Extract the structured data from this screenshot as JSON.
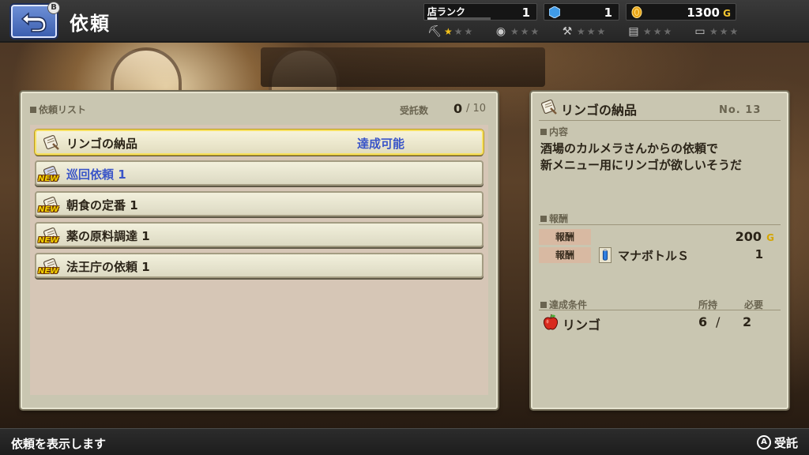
{
  "header": {
    "title": "依頼",
    "back_badge": "B",
    "shop_rank_label": "店ランク",
    "shop_rank_value": "1",
    "shop_rank_progress": 0.15,
    "gems_value": "1",
    "gold_value": "1300",
    "gold_unit": "G",
    "skills": [
      {
        "icon": "pickaxe-icon",
        "glyph": "⛏",
        "stars": 1
      },
      {
        "icon": "pot-icon",
        "glyph": "◉",
        "stars": 0
      },
      {
        "icon": "hammer-icon",
        "glyph": "⚒",
        "stars": 0
      },
      {
        "icon": "ladder-icon",
        "glyph": "▤",
        "stars": 0
      },
      {
        "icon": "scroll-icon",
        "glyph": "▭",
        "stars": 0
      }
    ]
  },
  "list_panel": {
    "heading": "依頼リスト",
    "count_label": "受託数",
    "count_current": "0",
    "count_max": "/ 10",
    "quests": [
      {
        "name": "リンゴの納品",
        "status": "達成可能",
        "is_new": false,
        "selected": true,
        "blue": false
      },
      {
        "name": "巡回依頼 1",
        "status": "",
        "is_new": true,
        "selected": false,
        "blue": true
      },
      {
        "name": "朝食の定番 1",
        "status": "",
        "is_new": true,
        "selected": false,
        "blue": false
      },
      {
        "name": "薬の原料調達 1",
        "status": "",
        "is_new": true,
        "selected": false,
        "blue": false
      },
      {
        "name": "法王庁の依頼 1",
        "status": "",
        "is_new": true,
        "selected": false,
        "blue": false
      }
    ],
    "new_label": "NEW"
  },
  "detail_panel": {
    "title": "リンゴの納品",
    "number": "No. 13",
    "content_heading": "内容",
    "description_line1": "酒場のカルメラさんからの依頼で",
    "description_line2": "新メニュー用にリンゴが欲しいそうだ",
    "reward_heading": "報酬",
    "rewards": [
      {
        "tag": "報酬",
        "value": "200",
        "unit": "G"
      },
      {
        "tag": "報酬",
        "item": "マナボトルＳ",
        "qty": "1"
      }
    ],
    "condition_heading": "達成条件",
    "have_label": "所持",
    "need_label": "必要",
    "condition": {
      "item": "リンゴ",
      "have": "6",
      "slash": "/",
      "need": "2"
    }
  },
  "footer": {
    "help_text": "依頼を表示します",
    "accept_badge": "A",
    "accept_label": "受託"
  },
  "colors": {
    "accent_blue": "#3a55c8",
    "gold": "#f2c530",
    "selected_border": "#f6e060"
  }
}
